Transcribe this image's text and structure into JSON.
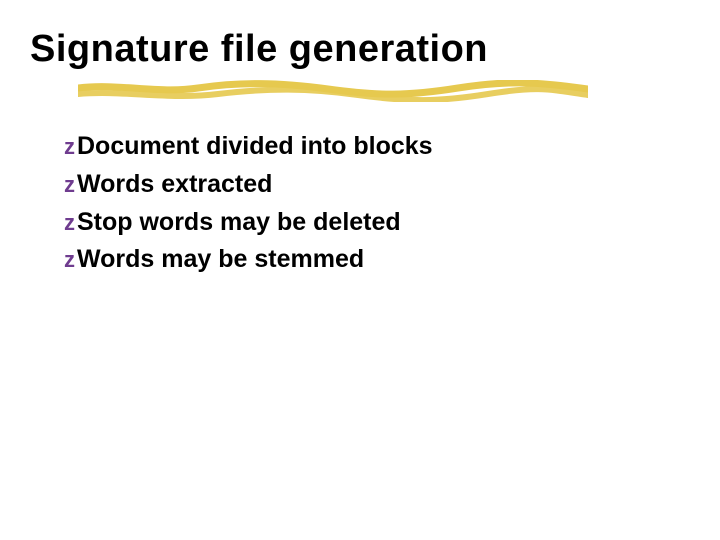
{
  "title": "Signature file generation",
  "bullets": [
    "Document divided into blocks",
    "Words extracted",
    "Stop words may be deleted",
    "Words may be stemmed"
  ],
  "icon_glyph": "z",
  "colors": {
    "accent_icon": "#6f3c8f",
    "underline": "#e6c94f"
  }
}
